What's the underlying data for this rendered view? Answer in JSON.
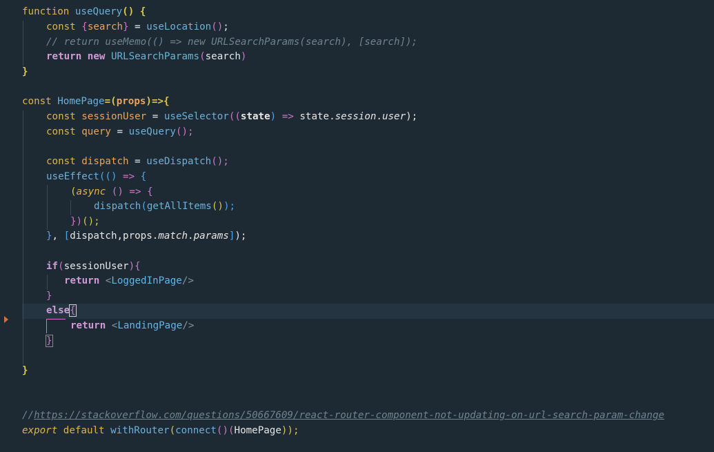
{
  "editor": {
    "lines": {
      "l1_kw": "function",
      "l1_name": "useQuery",
      "l1_open": "() {",
      "l2_kw": "const",
      "l2_obj_open": "{",
      "l2_var": "search",
      "l2_obj_close": "}",
      "l2_eq": " = ",
      "l2_fn": "useLocation",
      "l2_call": "()",
      "l2_end": ";",
      "l3_comment": "// return useMemo(() => new URLSearchParams(search), [search]);",
      "l4_kw": "return",
      "l4_kw2": "new",
      "l4_cls": "URLSearchParams",
      "l4_open": "(",
      "l4_arg": "search",
      "l4_close": ")",
      "l5": "}",
      "l7_kw": "const",
      "l7_name": "HomePage",
      "l7_eq": "=(",
      "l7_arg": "props",
      "l7_arrow": ")=>{",
      "l8_kw": "const",
      "l8_var": "sessionUser",
      "l8_eq": " = ",
      "l8_fn": "useSelector",
      "l8_open": "((",
      "l8_arg": "state",
      "l8_close": ")",
      "l8_arrow": " => ",
      "l8_obj": "state.",
      "l8_prop": "session",
      "l8_dot": ".",
      "l8_prop2": "user",
      "l8_end": ");",
      "l9_kw": "const",
      "l9_var": "query",
      "l9_eq": " = ",
      "l9_fn": "useQuery",
      "l9_end": "();",
      "l11_kw": "const",
      "l11_var": "dispatch",
      "l11_eq": " = ",
      "l11_fn": "useDispatch",
      "l11_end": "();",
      "l12_fn": "useEffect",
      "l12_open": "(()",
      "l12_arrow": " => ",
      "l12_brace": "{",
      "l13_open": "(",
      "l13_kw": "async",
      "l13_paren": " ()",
      "l13_arrow": " => ",
      "l13_brace": "{",
      "l14_fn": "dispatch",
      "l14_open": "(",
      "l14_fn2": "getAllItems",
      "l14_call": "()",
      "l14_end": ");",
      "l15_close": "})",
      "l15_end": "();",
      "l16_brace": "}",
      "l16_comma": ", ",
      "l16_arr": "[",
      "l16_items": "dispatch,props.",
      "l16_prop": "match",
      "l16_dot": ".",
      "l16_prop2": "params",
      "l16_arr_close": "]",
      "l16_end": ");",
      "l18_kw": "if",
      "l18_open": "(",
      "l18_arg": "sessionUser",
      "l18_close": "){",
      "l19_kw": "return",
      "l19_lt": "<",
      "l19_tag": "LoggedInPage",
      "l19_gt": "/>",
      "l20": "}",
      "l21_kw": "else",
      "l21_brace": "{",
      "l22_kw": "return",
      "l22_lt": "<",
      "l22_tag": "LandingPage",
      "l22_gt": "/>",
      "l23": "}",
      "l25": "}",
      "l28_comment_prefix": "//",
      "l28_url": "https://stackoverflow.com/questions/50667609/react-router-component-not-updating-on-url-search-param-change",
      "l29_kw": "export",
      "l29_kw2": "default",
      "l29_fn": "withRouter",
      "l29_open": "(",
      "l29_fn2": "connect",
      "l29_call": "()",
      "l29_arg_open": "(",
      "l29_arg": "HomePage",
      "l29_end": "));"
    }
  }
}
